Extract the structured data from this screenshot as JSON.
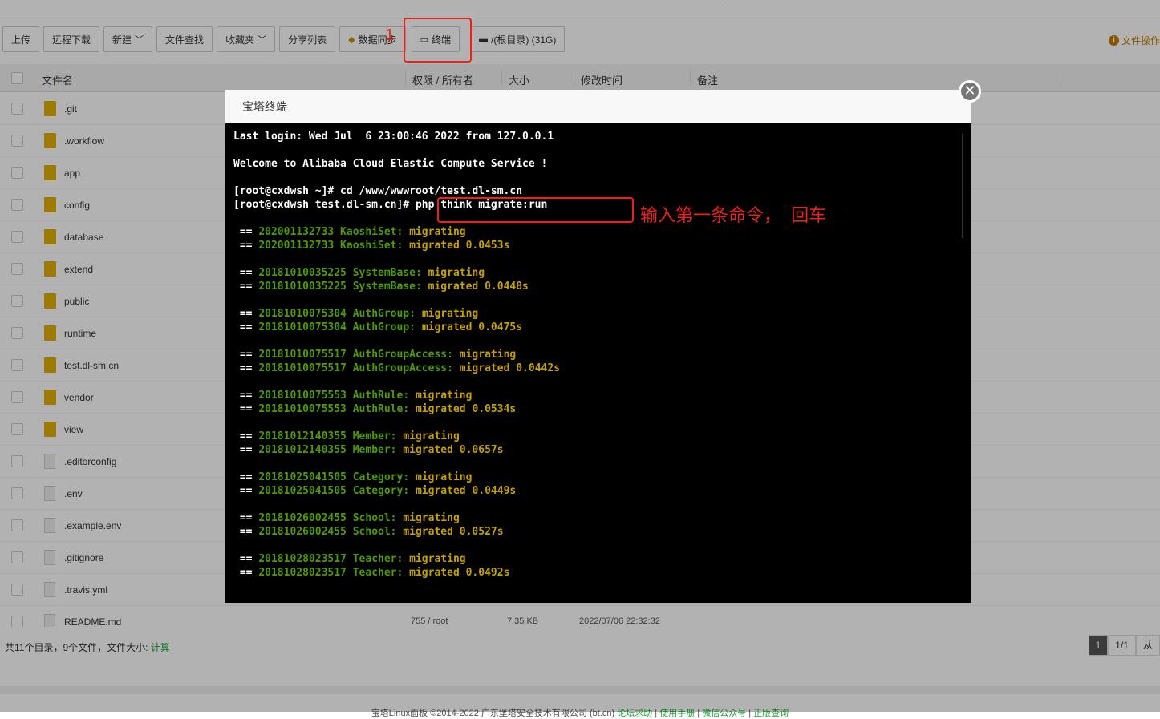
{
  "toolbar": {
    "upload": "上传",
    "remote_download": "远程下载",
    "new": "新建",
    "file_search": "文件查找",
    "favorites": "收藏夹",
    "share_list": "分享列表",
    "data_sync": "数据同步",
    "terminal": "终端",
    "disk": "/(根目录) (31G)",
    "file_ops": "文件操作"
  },
  "table": {
    "headers": {
      "name": "文件名",
      "perm": "权限 / 所有者",
      "size": "大小",
      "mtime": "修改时间",
      "note": "备注"
    },
    "rows": [
      {
        "name": ".git",
        "type": "folder"
      },
      {
        "name": ".workflow",
        "type": "folder"
      },
      {
        "name": "app",
        "type": "folder"
      },
      {
        "name": "config",
        "type": "folder"
      },
      {
        "name": "database",
        "type": "folder"
      },
      {
        "name": "extend",
        "type": "folder"
      },
      {
        "name": "public",
        "type": "folder"
      },
      {
        "name": "runtime",
        "type": "folder"
      },
      {
        "name": "test.dl-sm.cn",
        "type": "folder"
      },
      {
        "name": "vendor",
        "type": "folder"
      },
      {
        "name": "view",
        "type": "folder"
      },
      {
        "name": ".editorconfig",
        "type": "file"
      },
      {
        "name": ".env",
        "type": "file"
      },
      {
        "name": ".example.env",
        "type": "file"
      },
      {
        "name": ".gitignore",
        "type": "file"
      },
      {
        "name": ".travis.yml",
        "type": "file"
      },
      {
        "name": "README.md",
        "type": "file",
        "perm": "755 / root",
        "size": "7.35 KB",
        "mtime": "2022/07/06 22:32:32"
      }
    ]
  },
  "status": {
    "summary": "共11个目录，9个文件，文件大小: ",
    "calc": "计算",
    "page": "1",
    "pages": "1/1",
    "from": "从"
  },
  "footer": {
    "copy": "宝塔Linux面板 ©2014-2022 广东堡塔安全技术有限公司 (bt.cn)",
    "links": [
      "论坛求助",
      "使用手册",
      "微信公众号",
      "正版查询"
    ]
  },
  "modal": {
    "title": "宝塔终端",
    "lines": [
      "Last login: Wed Jul  6 23:00:46 2022 from 127.0.0.1",
      "",
      "Welcome to Alibaba Cloud Elastic Compute Service !",
      "",
      "[root@cxdwsh ~]# cd /www/wwwroot/test.dl-sm.cn",
      "[root@cxdwsh test.dl-sm.cn]# php think migrate:run",
      ""
    ],
    "migrations": [
      {
        "id": "202001132733 KaoshiSet:",
        "time": "0.0453s"
      },
      {
        "id": "20181010035225 SystemBase:",
        "time": "0.0448s"
      },
      {
        "id": "20181010075304 AuthGroup:",
        "time": "0.0475s"
      },
      {
        "id": "20181010075517 AuthGroupAccess:",
        "time": "0.0442s"
      },
      {
        "id": "20181010075553 AuthRule:",
        "time": "0.0534s"
      },
      {
        "id": "20181012140355 Member:",
        "time": "0.0657s"
      },
      {
        "id": "20181025041505 Category:",
        "time": "0.0449s"
      },
      {
        "id": "20181026002455 School:",
        "time": "0.0527s"
      },
      {
        "id": "20181028023517 Teacher:",
        "time": "0.0492s"
      }
    ],
    "migrating": "migrating",
    "migrated": "migrated"
  },
  "annotations": {
    "step1": "1",
    "step2": "输入第一条命令，  回车"
  }
}
